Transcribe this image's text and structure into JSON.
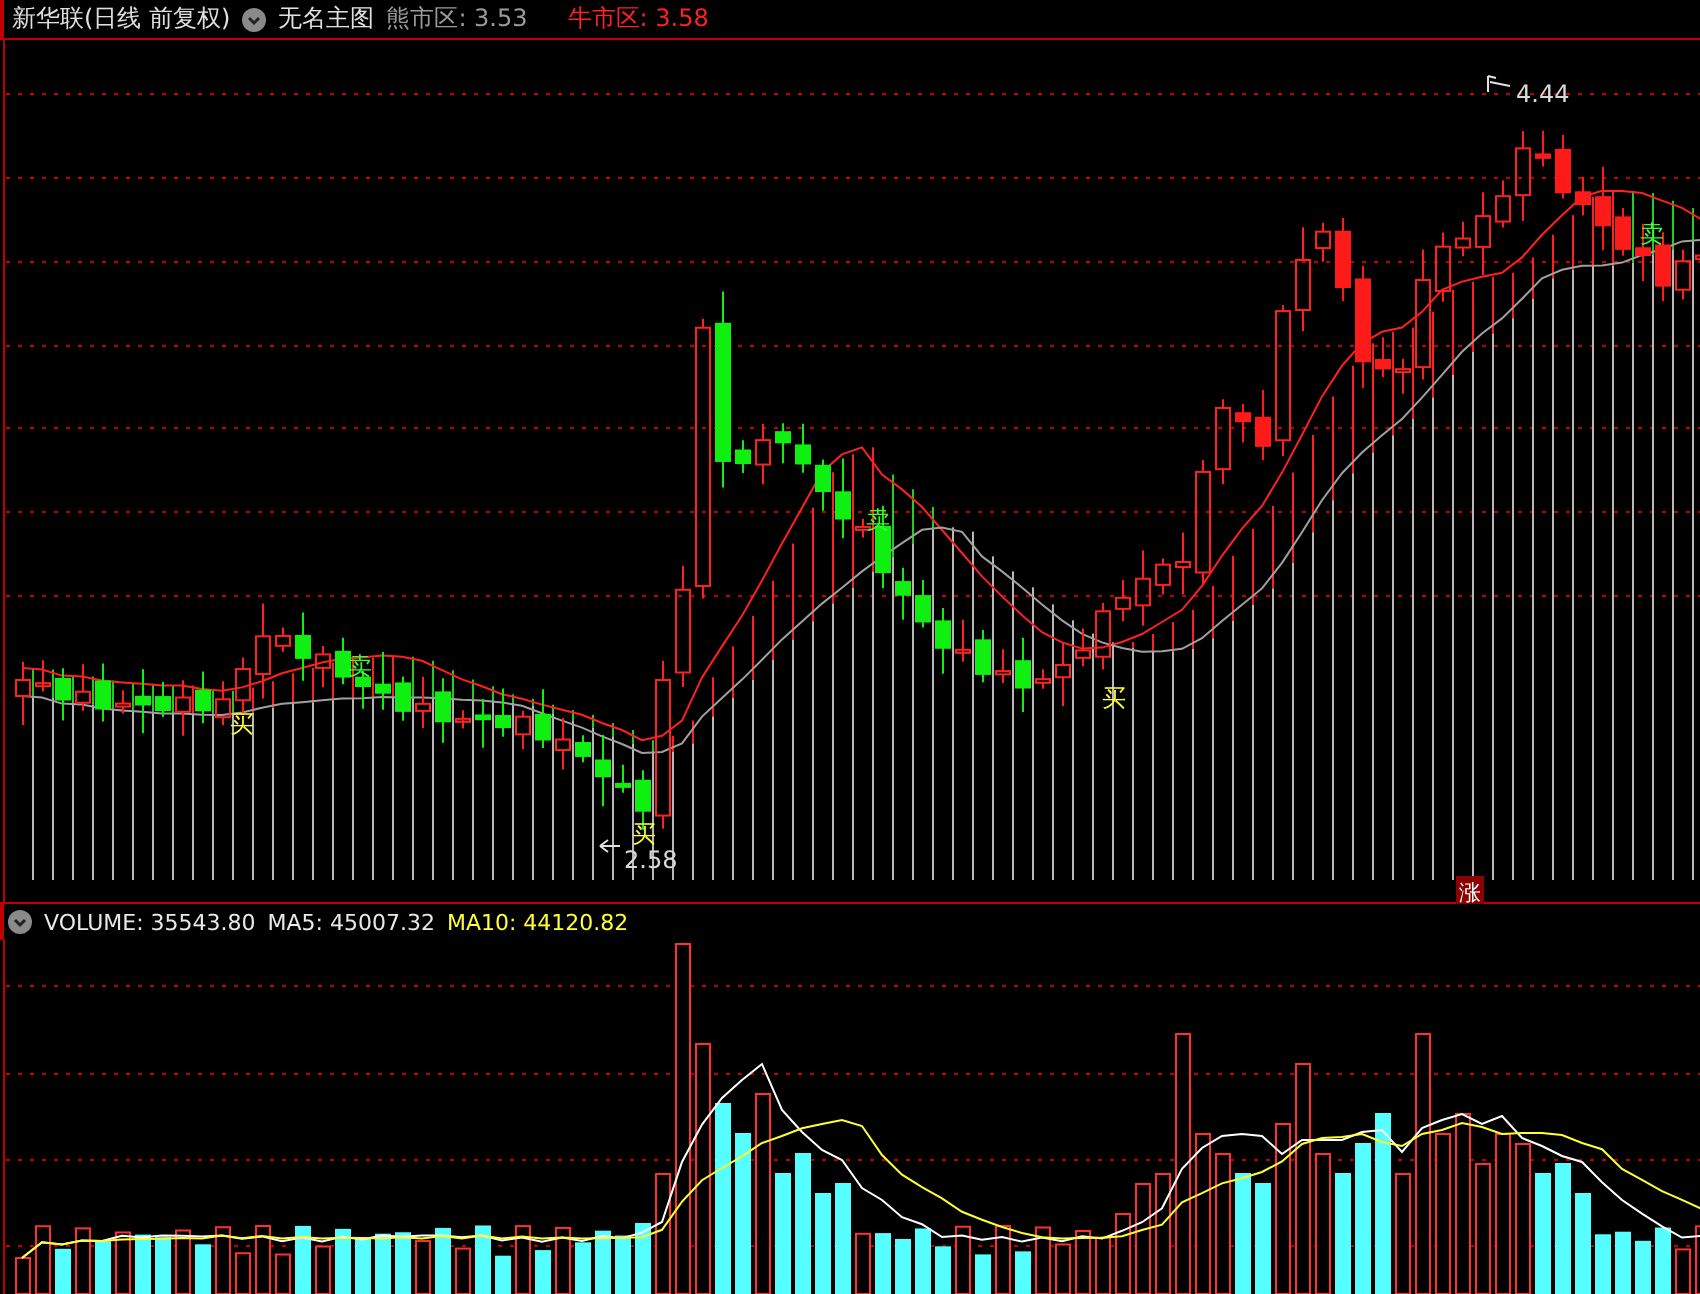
{
  "header": {
    "title": "新华联(日线 前复权)",
    "indicator": "无名主图",
    "legend": [
      {
        "text": "熊市区: 3.53",
        "color": "#9a9a9a"
      },
      {
        "text": "牛市区: 3.58",
        "color": "#ff2020"
      }
    ]
  },
  "price_chart": {
    "markers": [
      {
        "text": "买",
        "kind": "buy"
      },
      {
        "text": "卖",
        "kind": "sell"
      },
      {
        "text": "买",
        "kind": "buy"
      },
      {
        "text": "卖",
        "kind": "sell"
      },
      {
        "text": "买",
        "kind": "buy"
      },
      {
        "text": "卖",
        "kind": "sell"
      }
    ],
    "low_label": "2.58",
    "high_label": "4.44",
    "badge": "涨"
  },
  "volume_panel": {
    "legend": [
      {
        "text": "VOLUME: 35543.80",
        "color": "#e8e8e8"
      },
      {
        "text": "MA5: 45007.32",
        "color": "#e8e8e8"
      },
      {
        "text": "MA10: 44120.82",
        "color": "#ffff33"
      }
    ]
  }
}
